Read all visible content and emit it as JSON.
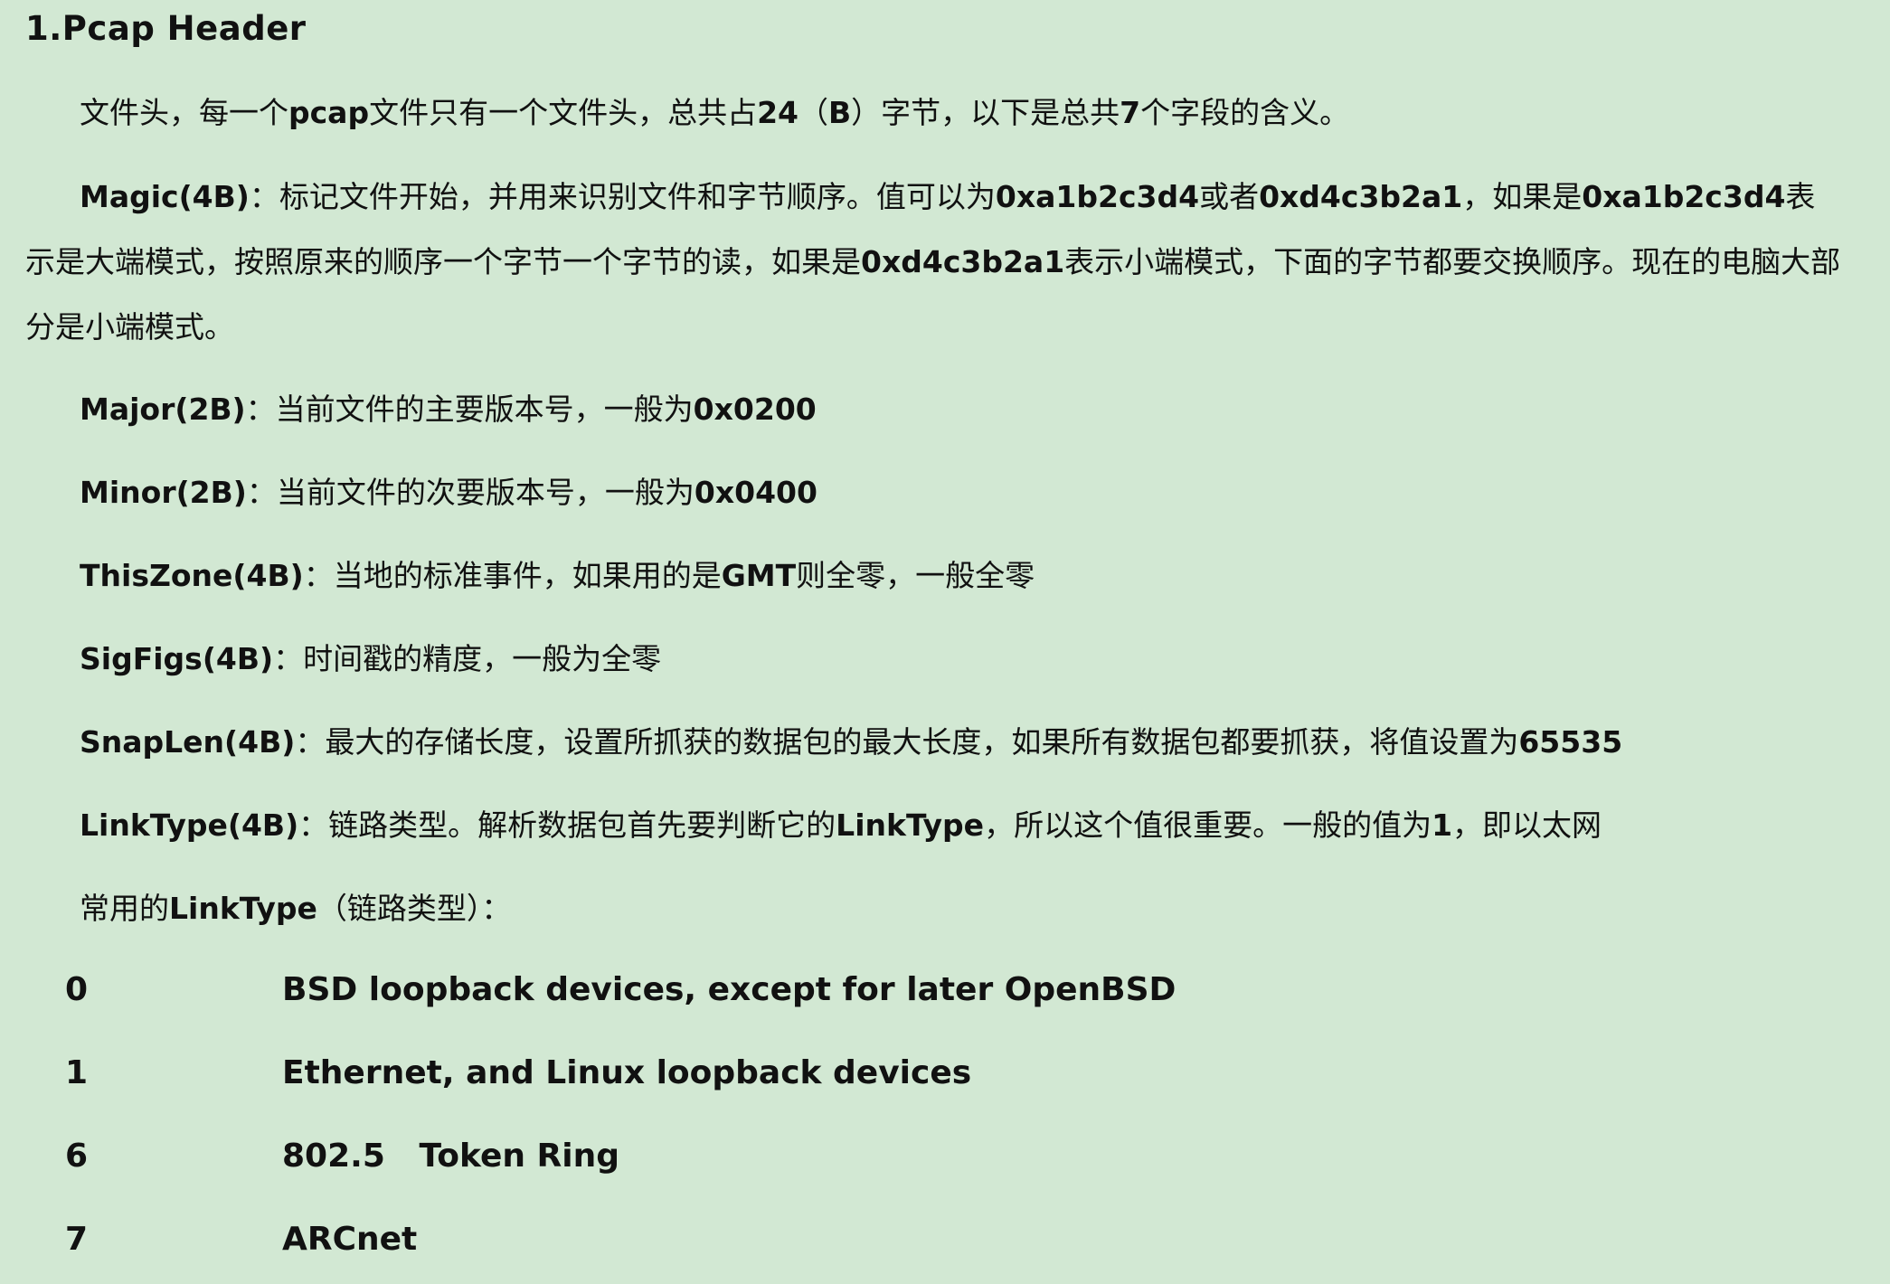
{
  "heading": "1.Pcap Header",
  "intro": {
    "p1": "文件头，每一个",
    "b1": "pcap",
    "p2": "文件只有一个文件头，总共占",
    "b2": "24",
    "p3": "（",
    "b3": "B",
    "p4": "）字节，以下是总共",
    "b4": "7",
    "p5": "个字段的含义。"
  },
  "magic": {
    "term": "Magic(4B)",
    "p1": "：标记文件开始，并用来识别文件和字节顺序。值可以为",
    "b1": "0xa1b2c3d4",
    "p2": "或者",
    "b2": "0xd4c3b2a1",
    "p3": "，如果是",
    "b3": "0xa1b2c3d4",
    "p4": "表示是大端模式，按照原来的顺序一个字节一个字节的读，如果是",
    "b4": "0xd4c3b2a1",
    "p5": "表示小端模式，下面的字节都要交换顺序。现在的电脑大部分是小端模式。"
  },
  "major": {
    "term": "Major(2B)",
    "p1": "：当前文件的主要版本号，一般为",
    "b1": "0x0200"
  },
  "minor": {
    "term": "Minor(2B)",
    "p1": "：当前文件的次要版本号，一般为",
    "b1": "0x0400"
  },
  "thiszone": {
    "term": "ThisZone(4B)",
    "p1": "：当地的标准事件，如果用的是",
    "b1": "GMT",
    "p2": "则全零，一般全零"
  },
  "sigfigs": {
    "term": "SigFigs(4B)",
    "p1": "：时间戳的精度，一般为全零"
  },
  "snaplen": {
    "term": "SnapLen(4B)",
    "p1": "：最大的存储长度，设置所抓获的数据包的最大长度，如果所有数据包都要抓获，将值设置为",
    "b1": "65535"
  },
  "linktype": {
    "term": "LinkType(4B)",
    "p1": "：链路类型。解析数据包首先要判断它的",
    "b1": "LinkType",
    "p2": "，所以这个值很重要。一般的值为",
    "b2": "1",
    "p3": "，即以太网"
  },
  "common": {
    "p1": "常用的",
    "b1": "LinkType",
    "p2": "（链路类型）："
  },
  "linktypes": [
    {
      "code": "0",
      "desc": "BSD loopback devices, except for later OpenBSD"
    },
    {
      "code": "1",
      "desc": "Ethernet, and Linux loopback devices"
    },
    {
      "code": "6",
      "desc": "802.5   Token Ring"
    },
    {
      "code": "7",
      "desc": "ARCnet"
    }
  ]
}
